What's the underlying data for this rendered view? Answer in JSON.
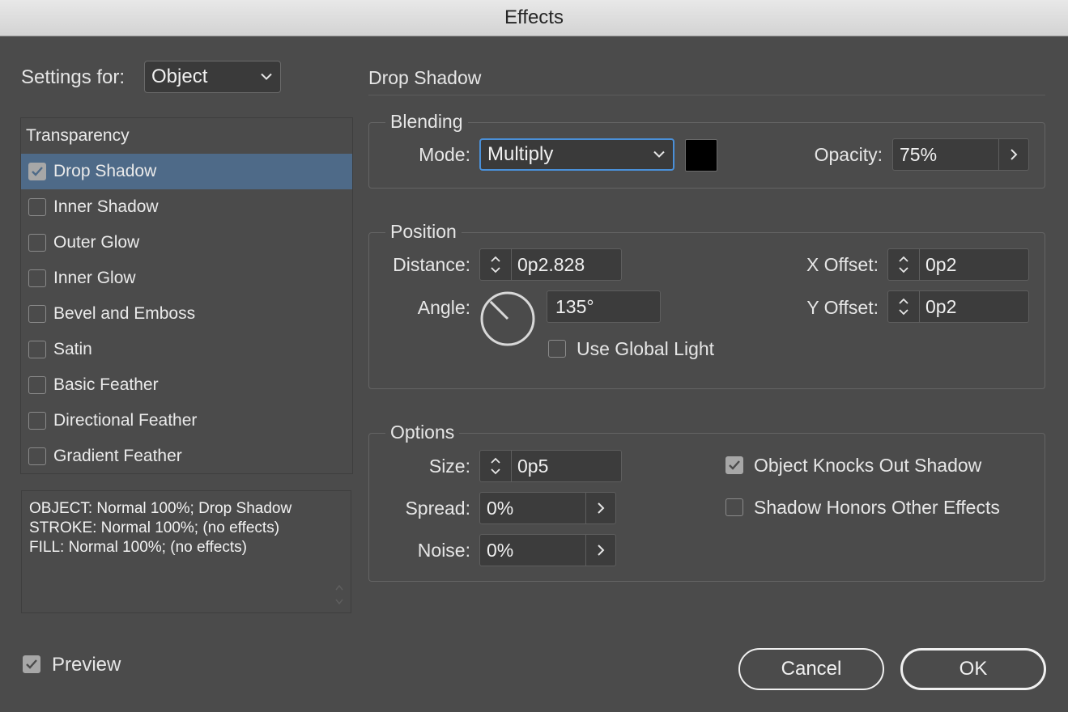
{
  "window": {
    "title": "Effects"
  },
  "settings_for": {
    "label": "Settings for:",
    "value": "Object"
  },
  "effects_list": {
    "header": "Transparency",
    "items": [
      {
        "label": "Drop Shadow",
        "checked": true,
        "selected": true
      },
      {
        "label": "Inner Shadow",
        "checked": false,
        "selected": false
      },
      {
        "label": "Outer Glow",
        "checked": false,
        "selected": false
      },
      {
        "label": "Inner Glow",
        "checked": false,
        "selected": false
      },
      {
        "label": "Bevel and Emboss",
        "checked": false,
        "selected": false
      },
      {
        "label": "Satin",
        "checked": false,
        "selected": false
      },
      {
        "label": "Basic Feather",
        "checked": false,
        "selected": false
      },
      {
        "label": "Directional Feather",
        "checked": false,
        "selected": false
      },
      {
        "label": "Gradient Feather",
        "checked": false,
        "selected": false
      }
    ]
  },
  "summary": {
    "lines": [
      "OBJECT: Normal 100%; Drop Shadow",
      "STROKE: Normal 100%; (no effects)",
      "FILL: Normal 100%; (no effects)"
    ]
  },
  "preview": {
    "label": "Preview",
    "checked": true
  },
  "panel": {
    "title": "Drop Shadow"
  },
  "blending": {
    "title": "Blending",
    "mode_label": "Mode:",
    "mode_value": "Multiply",
    "color": "#000000",
    "opacity_label": "Opacity:",
    "opacity_value": "75%"
  },
  "position": {
    "title": "Position",
    "distance_label": "Distance:",
    "distance_value": "0p2.828",
    "angle_label": "Angle:",
    "angle_value": "135°",
    "angle_degrees": 135,
    "global_light_label": "Use Global Light",
    "global_light_checked": false,
    "x_offset_label": "X Offset:",
    "x_offset_value": "0p2",
    "y_offset_label": "Y Offset:",
    "y_offset_value": "0p2"
  },
  "options": {
    "title": "Options",
    "size_label": "Size:",
    "size_value": "0p5",
    "spread_label": "Spread:",
    "spread_value": "0%",
    "noise_label": "Noise:",
    "noise_value": "0%",
    "knockout_label": "Object Knocks Out Shadow",
    "knockout_checked": true,
    "honors_label": "Shadow Honors Other Effects",
    "honors_checked": false
  },
  "buttons": {
    "cancel": "Cancel",
    "ok": "OK"
  },
  "colors": {
    "background": "#4b4b4b",
    "selection": "#4e6a88",
    "focus": "#4a90d9"
  }
}
